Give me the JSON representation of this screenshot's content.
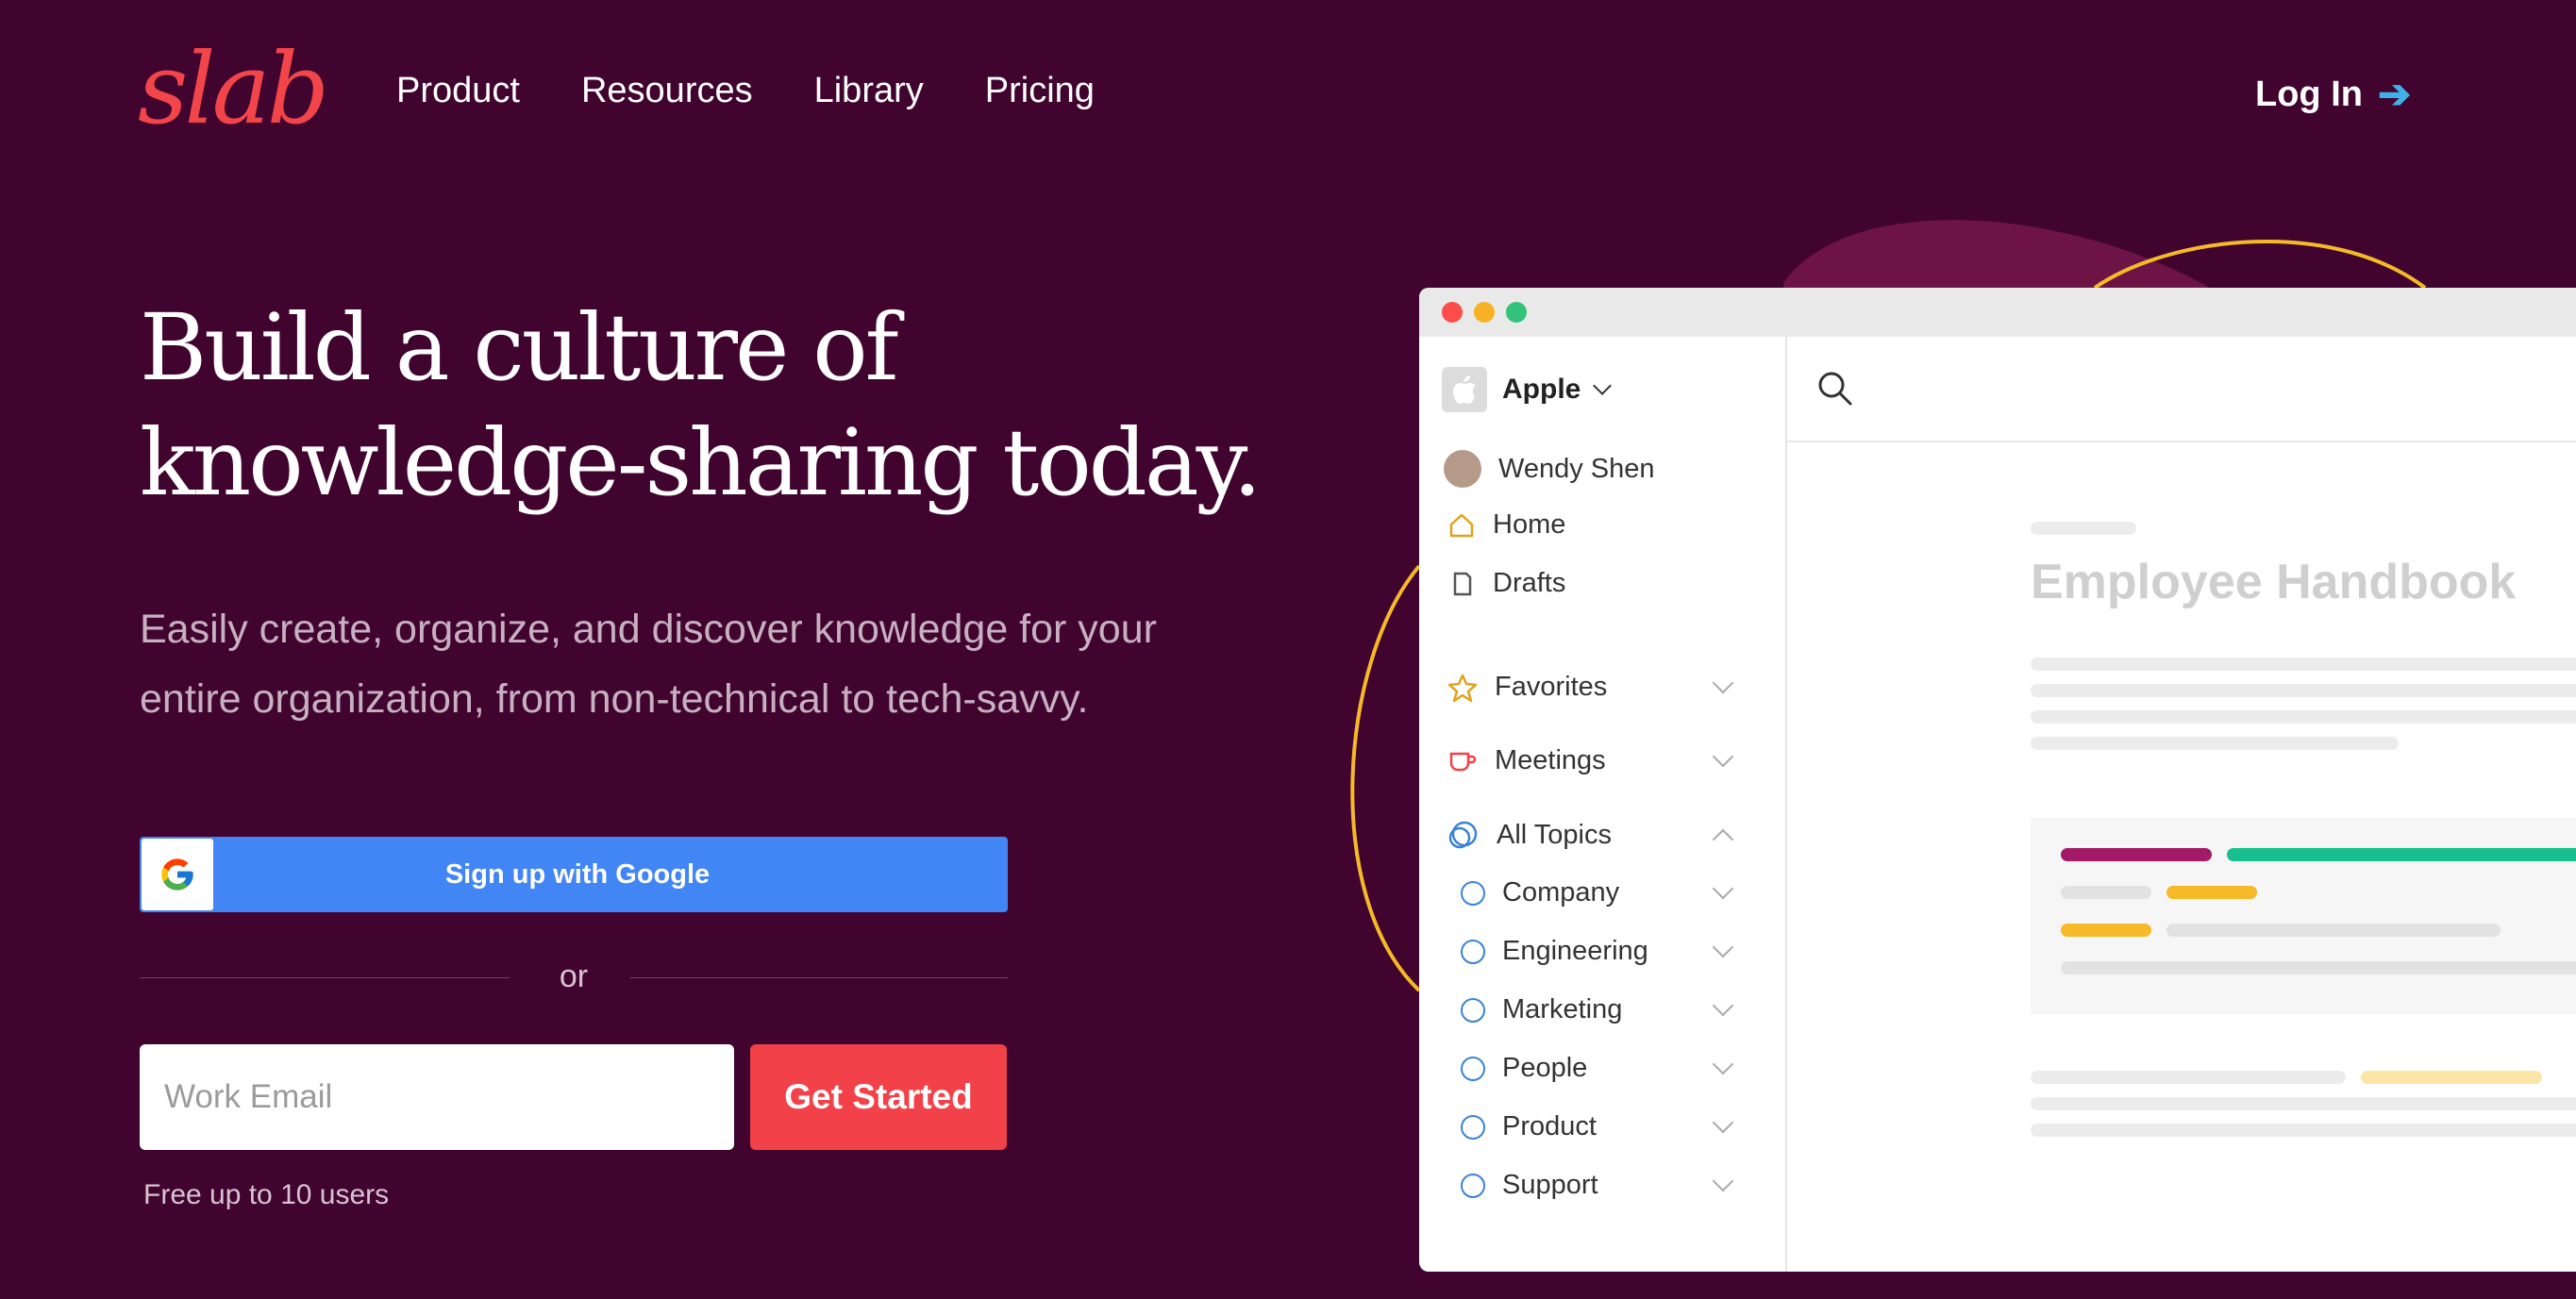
{
  "brand": {
    "logo_text": "slab",
    "logo_color": "#f2454a",
    "background": "#40042f"
  },
  "nav": {
    "links": [
      "Product",
      "Resources",
      "Library",
      "Pricing"
    ],
    "login_label": "Log In",
    "login_arrow_icon": "arrow-right-icon"
  },
  "hero": {
    "headline_line1": "Build a culture of",
    "headline_line2": "knowledge-sharing today.",
    "subhead": "Easily create, organize, and discover knowledge for your entire organization, from non-technical to tech-savvy."
  },
  "signup": {
    "google_label": "Sign up with Google",
    "or_text": "or",
    "email_placeholder": "Work Email",
    "email_value": "",
    "cta_label": "Get Started",
    "note": "Free up to 10 users",
    "google_color": "#4285f4",
    "cta_color": "#f24149"
  },
  "app": {
    "workspace": "Apple",
    "user": "Wendy Shen",
    "nav_items": [
      "Home",
      "Drafts"
    ],
    "sections": [
      "Favorites",
      "Meetings",
      "All Topics"
    ],
    "topics": [
      "Company",
      "Engineering",
      "Marketing",
      "People",
      "Product",
      "Support"
    ],
    "doc_title": "Employee Handbook",
    "window_dots": [
      "#fc4d4a",
      "#f7b125",
      "#33c27a"
    ]
  }
}
